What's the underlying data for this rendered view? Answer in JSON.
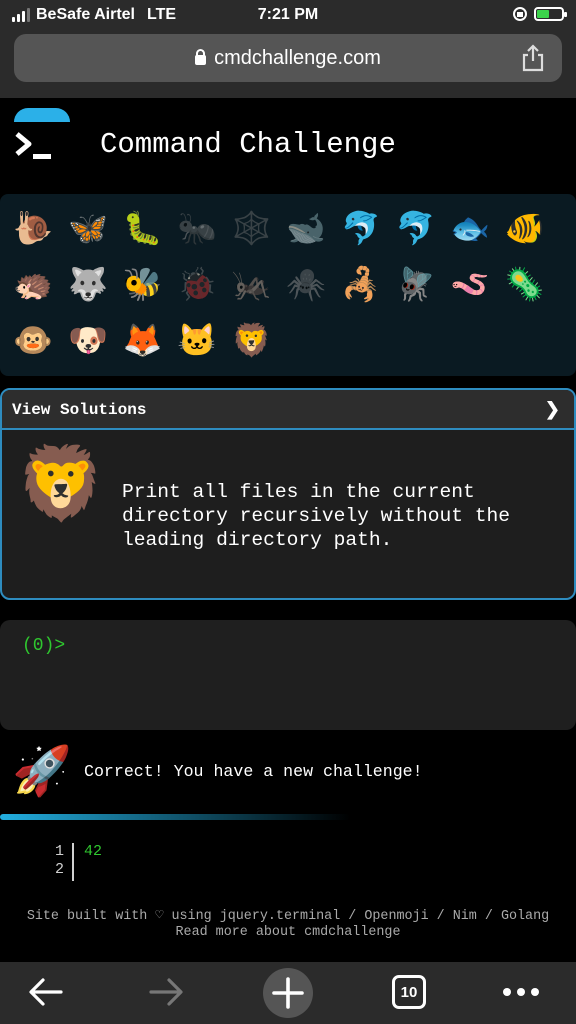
{
  "status": {
    "carrier": "BeSafe Airtel",
    "network": "LTE",
    "time": "7:21 PM"
  },
  "browser": {
    "url": "cmdchallenge.com",
    "tabs_count": "10"
  },
  "header": {
    "title": "Command Challenge"
  },
  "challenges": {
    "rows": [
      [
        {
          "emoji": "🐌",
          "name": "snail-icon"
        },
        {
          "emoji": "🦋",
          "name": "butterfly-icon"
        },
        {
          "emoji": "🐛",
          "name": "caterpillar-icon"
        },
        {
          "emoji": "🐜",
          "name": "ant-icon"
        },
        {
          "emoji": "🕸️",
          "name": "spider-web-icon"
        },
        {
          "emoji": "🐋",
          "name": "whale-icon"
        },
        {
          "emoji": "🐬",
          "name": "dolphin-icon"
        },
        {
          "emoji": "🐬",
          "name": "dolphin-gray-icon"
        },
        {
          "emoji": "🐟",
          "name": "fish-icon"
        },
        {
          "emoji": "🐠",
          "name": "tropical-fish-icon"
        }
      ],
      [
        {
          "emoji": "🦔",
          "name": "hedgehog-icon"
        },
        {
          "emoji": "🐺",
          "name": "wolf-icon"
        },
        {
          "emoji": "🐝",
          "name": "bee-icon"
        },
        {
          "emoji": "🐞",
          "name": "ladybug-icon"
        },
        {
          "emoji": "🦗",
          "name": "cricket-icon"
        },
        {
          "emoji": "🕷️",
          "name": "spider-icon"
        },
        {
          "emoji": "🦂",
          "name": "scorpion-icon"
        },
        {
          "emoji": "🪰",
          "name": "fly-icon"
        },
        {
          "emoji": "🪱",
          "name": "worm-icon"
        },
        {
          "emoji": "🦠",
          "name": "microbe-icon"
        }
      ],
      [
        {
          "emoji": "🐵",
          "name": "monkey-icon"
        },
        {
          "emoji": "🐶",
          "name": "dog-icon"
        },
        {
          "emoji": "🦊",
          "name": "fox-icon"
        },
        {
          "emoji": "🐱",
          "name": "cat-icon"
        },
        {
          "emoji": "🦁",
          "name": "lion-icon"
        }
      ]
    ]
  },
  "solutions": {
    "label": "View Solutions",
    "chevron": "❯",
    "emoji": "🦁",
    "description": "Print all files in the current directory recursively without the leading directory path."
  },
  "terminal": {
    "prompt": "(0)>"
  },
  "result": {
    "emoji": "🚀",
    "message": "Correct! You have a new challenge!"
  },
  "output": {
    "line_numbers": [
      "1",
      "2"
    ],
    "code": "42"
  },
  "footer": {
    "line1": "Site built with ♡ using jquery.terminal / Openmoji / Nim / Golang",
    "line2": "Read more about cmdchallenge"
  },
  "colors": {
    "accent": "#2e8cbf",
    "prompt_green": "#2fc72f",
    "battery_green": "#3cd34b"
  }
}
